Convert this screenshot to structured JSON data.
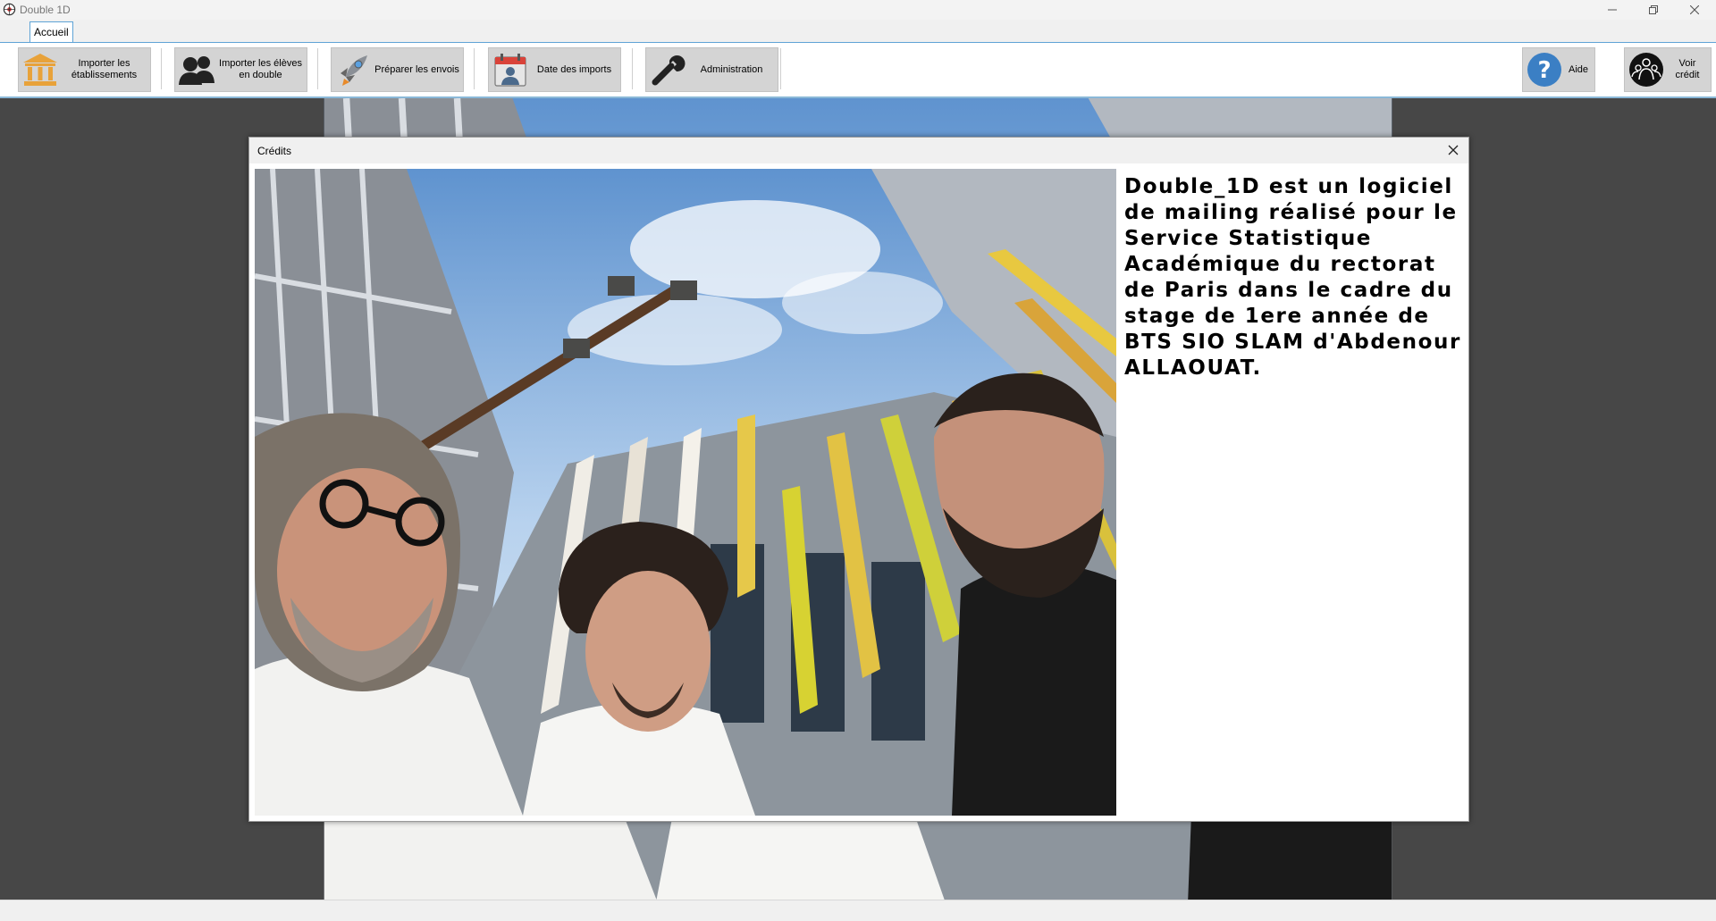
{
  "window": {
    "title": "Double 1D"
  },
  "tabs": [
    {
      "label": "Accueil"
    }
  ],
  "toolbar": {
    "buttons": [
      {
        "label": "Importer les établissements",
        "line1": "Importer les",
        "line2": "établissements",
        "icon": "bank-icon"
      },
      {
        "label": "Importer les élèves en double",
        "line1": "Importer les élèves",
        "line2": "en double",
        "icon": "users-icon"
      },
      {
        "label": "Préparer les envois",
        "icon": "rocket-icon"
      },
      {
        "label": "Date des imports",
        "icon": "calendar-user-icon"
      },
      {
        "label": "Administration",
        "icon": "wrench-icon"
      },
      {
        "label": "Aide",
        "icon": "question-icon"
      },
      {
        "label": "Voir crédit",
        "icon": "team-icon"
      }
    ]
  },
  "dialog": {
    "title": "Crédits",
    "text": "Double_1D est un logiciel de mailing réalisé pour le Service Statistique Académique du rectorat de Paris dans le cadre du stage de 1ere année de BTS SIO SLAM d'Abdenour ALLAOUAT."
  },
  "colors": {
    "accent": "#5fa3d6",
    "button_bg": "#d4d4d4",
    "workspace": "#474747",
    "help_blue": "#3b7fc4"
  }
}
